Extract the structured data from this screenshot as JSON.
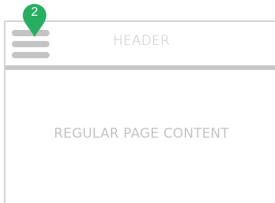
{
  "header": {
    "title": "HEADER",
    "menu_icon": "hamburger-menu-icon"
  },
  "content": {
    "placeholder": "REGULAR PAGE CONTENT"
  },
  "annotation": {
    "step_number": "2",
    "marker_icon": "map-pin-icon",
    "color": "#27ae60"
  },
  "colors": {
    "placeholder_gray": "#c4c4c4",
    "frame_gray": "#d4d4d4"
  }
}
